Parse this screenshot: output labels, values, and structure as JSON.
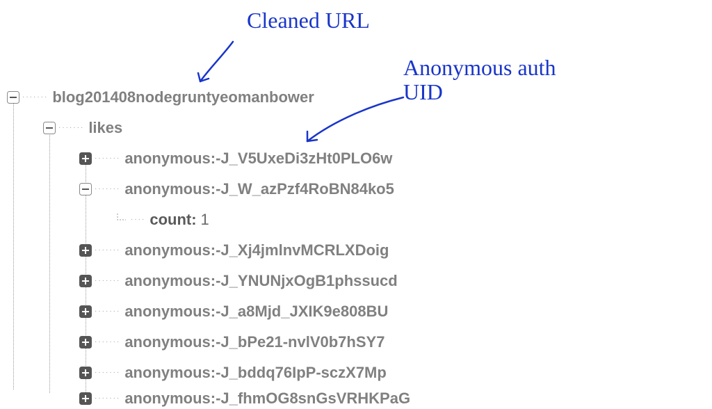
{
  "tree": {
    "root_label": "blog201408nodegruntyeomanbower",
    "likes_label": "likes",
    "count_key": "count:",
    "count_value": "1",
    "uids": [
      "anonymous:-J_V5UxeDi3zHt0PLO6w",
      "anonymous:-J_W_azPzf4RoBN84ko5",
      "anonymous:-J_Xj4jmlnvMCRLXDoig",
      "anonymous:-J_YNUNjxOgB1phssucd",
      "anonymous:-J_a8Mjd_JXIK9e808BU",
      "anonymous:-J_bPe21-nvlV0b7hSY7",
      "anonymous:-J_bddq76IpP-sczX7Mp",
      "anonymous:-J_fhmOG8snGsVRHKPaG"
    ]
  },
  "annotations": {
    "cleaned_url": "Cleaned URL",
    "anon_uid_l1": "Anonymous auth",
    "anon_uid_l2": "UID"
  },
  "colors": {
    "ink": "#1935c9",
    "tree_text": "#808080",
    "key_text": "#5a5a5a"
  }
}
